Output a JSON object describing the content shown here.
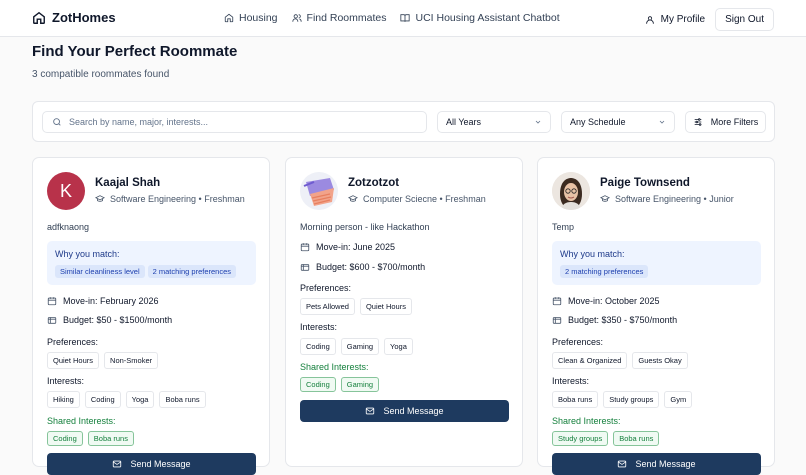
{
  "nav": {
    "brand": "ZotHomes",
    "links": [
      "Housing",
      "Find Roommates",
      "UCI Housing Assistant Chatbot"
    ],
    "profile": "My Profile",
    "signout": "Sign Out"
  },
  "page": {
    "title": "Find Your Perfect Roommate",
    "subtitle": "3 compatible roommates found"
  },
  "filters": {
    "search_placeholder": "Search by name, major, interests...",
    "year": "All Years",
    "schedule": "Any Schedule",
    "more": "More Filters"
  },
  "labels": {
    "why": "Why you match:",
    "preferences": "Preferences:",
    "interests": "Interests:",
    "shared": "Shared Interests:",
    "send": "Send Message"
  },
  "cards": [
    {
      "name": "Kaajal Shah",
      "initial": "K",
      "major": "Software Engineering • Freshman",
      "bio": "adfknaong",
      "match": [
        "Similar cleanliness level",
        "2 matching preferences"
      ],
      "movein": "Move-in: February 2026",
      "budget": "Budget: $50 - $1500/month",
      "preferences": [
        "Quiet Hours",
        "Non-Smoker"
      ],
      "interests": [
        "Hiking",
        "Coding",
        "Yoga",
        "Boba runs"
      ],
      "shared": [
        "Coding",
        "Boba runs"
      ]
    },
    {
      "name": "Zotzotzot",
      "major": "Computer Sciecne • Freshman",
      "bio": "Morning person - like Hackathon",
      "movein": "Move-in: June 2025",
      "budget": "Budget: $600 - $700/month",
      "preferences": [
        "Pets Allowed",
        "Quiet Hours"
      ],
      "interests": [
        "Coding",
        "Gaming",
        "Yoga"
      ],
      "shared": [
        "Coding",
        "Gaming"
      ]
    },
    {
      "name": "Paige Townsend",
      "major": "Software Engineering • Junior",
      "bio": "Temp",
      "match": [
        "2 matching preferences"
      ],
      "movein": "Move-in: October 2025",
      "budget": "Budget: $350 - $750/month",
      "preferences": [
        "Clean & Organized",
        "Guests Okay"
      ],
      "interests": [
        "Boba runs",
        "Study groups",
        "Gym"
      ],
      "shared": [
        "Study groups",
        "Boba runs"
      ]
    }
  ],
  "colors": {
    "accent": "#1e3a5f",
    "match_bg": "#eef4ff",
    "shared_green": "#15803d",
    "avatar_k": "#b8324a"
  }
}
